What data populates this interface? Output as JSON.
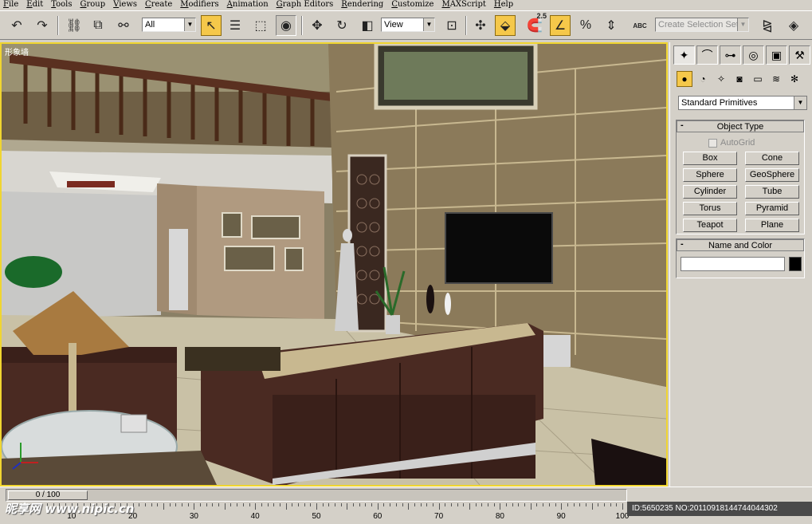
{
  "menu": [
    "File",
    "Edit",
    "Tools",
    "Group",
    "Views",
    "Create",
    "Modifiers",
    "Animation",
    "Graph Editors",
    "Rendering",
    "Customize",
    "MAXScript",
    "Help"
  ],
  "toolbar": {
    "filter_value": "All",
    "refcoord_value": "View",
    "snap_value": "2.5",
    "selection_set_placeholder": "Create Selection Set",
    "abc_label": "ABC"
  },
  "viewport": {
    "label": "形象墙"
  },
  "panel": {
    "category": "Standard Primitives",
    "object_type": {
      "title": "Object Type",
      "autogrid": "AutoGrid",
      "buttons": [
        "Box",
        "Cone",
        "Sphere",
        "GeoSphere",
        "Cylinder",
        "Tube",
        "Torus",
        "Pyramid",
        "Teapot",
        "Plane"
      ]
    },
    "name_color": {
      "title": "Name and Color",
      "name_value": "",
      "color": "#000000"
    }
  },
  "timeline": {
    "frame_readout": "0 / 100",
    "ticks": [
      "10",
      "20",
      "30",
      "40",
      "50",
      "60",
      "70",
      "80",
      "90",
      "100"
    ]
  },
  "watermark": "昵享网 www.nipic.cn",
  "id_stamp": "ID:5650235 NO:20110918144744044302"
}
